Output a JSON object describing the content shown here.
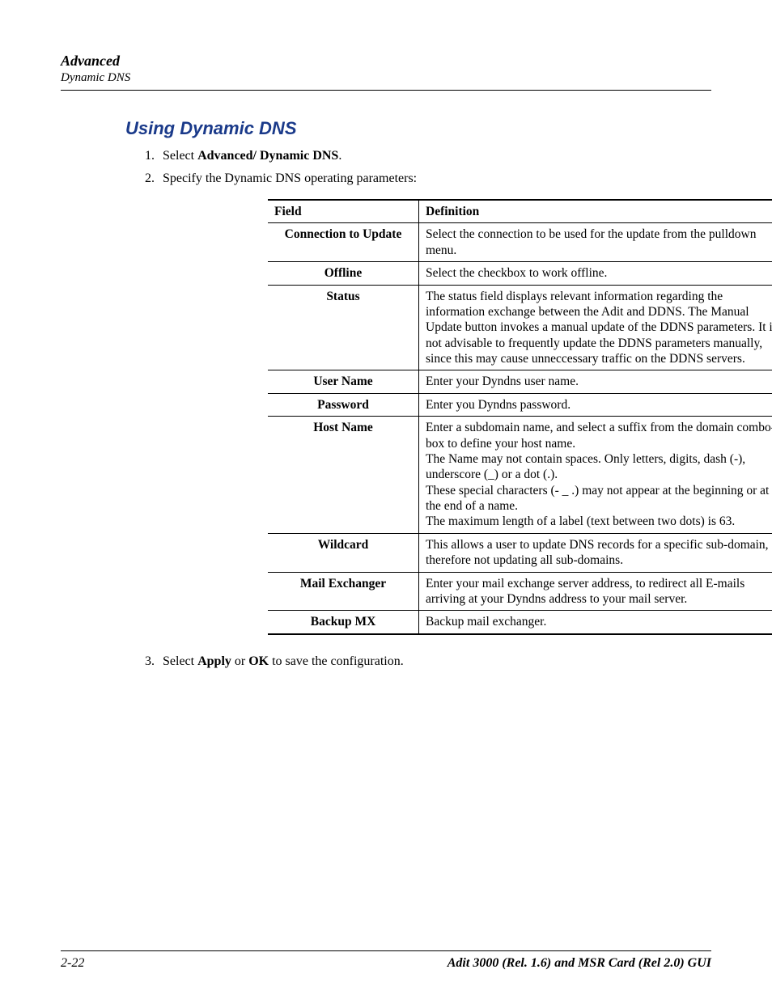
{
  "header": {
    "line1": "Advanced",
    "line2": "Dynamic DNS"
  },
  "section_title": "Using Dynamic DNS",
  "steps": {
    "s1_prefix": "Select ",
    "s1_bold": "Advanced/ Dynamic DNS",
    "s1_suffix": ".",
    "s2": "Specify the Dynamic DNS operating parameters:",
    "s3_prefix": "Select ",
    "s3_bold1": "Apply",
    "s3_mid": " or ",
    "s3_bold2": "OK",
    "s3_suffix": " to save the configuration."
  },
  "table": {
    "head_field": "Field",
    "head_def": "Definition",
    "rows": [
      {
        "field": "Connection to Update",
        "def1": "Select the connection to be used for the update from the pulldown menu."
      },
      {
        "field": "Offline",
        "def1": "Select the checkbox to work offline."
      },
      {
        "field": "Status",
        "def1": "The status field displays relevant information regarding the information exchange between the Adit and DDNS. The Manual Update button invokes a manual update of the DDNS parameters. It is not advisable to frequently update the DDNS parameters manually, since this may cause unneccessary traffic on the DDNS servers."
      },
      {
        "field": "User Name",
        "def1": "Enter your Dyndns user name."
      },
      {
        "field": "Password",
        "def1": "Enter you Dyndns password."
      },
      {
        "field": "Host Name",
        "def1": "Enter a subdomain name, and select a suffix from the domain combo-box to define your host name.",
        "def2": "The Name may not contain spaces. Only letters, digits, dash (-), underscore (_) or a dot (.).",
        "def3": "These special characters (- _ .) may not appear at the beginning or at the end of a name.",
        "def4": "The maximum length of a label (text between two dots) is 63."
      },
      {
        "field": "Wildcard",
        "def1": "This allows a user to update DNS records for a specific sub-domain, therefore not updating all sub-domains."
      },
      {
        "field": "Mail Exchanger",
        "def1": "Enter your mail exchange server address, to redirect all E-mails arriving at your Dyndns address to your mail server."
      },
      {
        "field": "Backup MX",
        "def1": "Backup mail exchanger."
      }
    ]
  },
  "footer": {
    "page_number": "2-22",
    "text": "Adit 3000 (Rel. 1.6) and MSR Card (Rel 2.0) GUI"
  }
}
